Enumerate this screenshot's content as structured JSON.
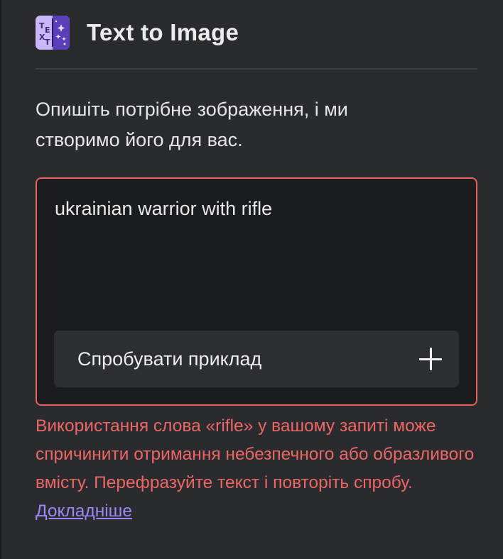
{
  "header": {
    "title": "Text to Image",
    "icon": "text-to-image-app-icon"
  },
  "description": "Опишіть потрібне зображення, і ми створимо його для вас.",
  "prompt": {
    "value": "ukrainian warrior with rifle",
    "border_color": "#e8605e"
  },
  "try_example": {
    "label": "Спробувати приклад",
    "icon": "plus-icon"
  },
  "warning": {
    "text": "Використання слова «rifle» у вашому запиті може спричинити отримання небезпечного або образливого вмісту. Перефразуйте текст і повторіть спробу.",
    "link_label": "Докладніше",
    "color": "#ec6664",
    "link_color": "#9b87f5"
  }
}
